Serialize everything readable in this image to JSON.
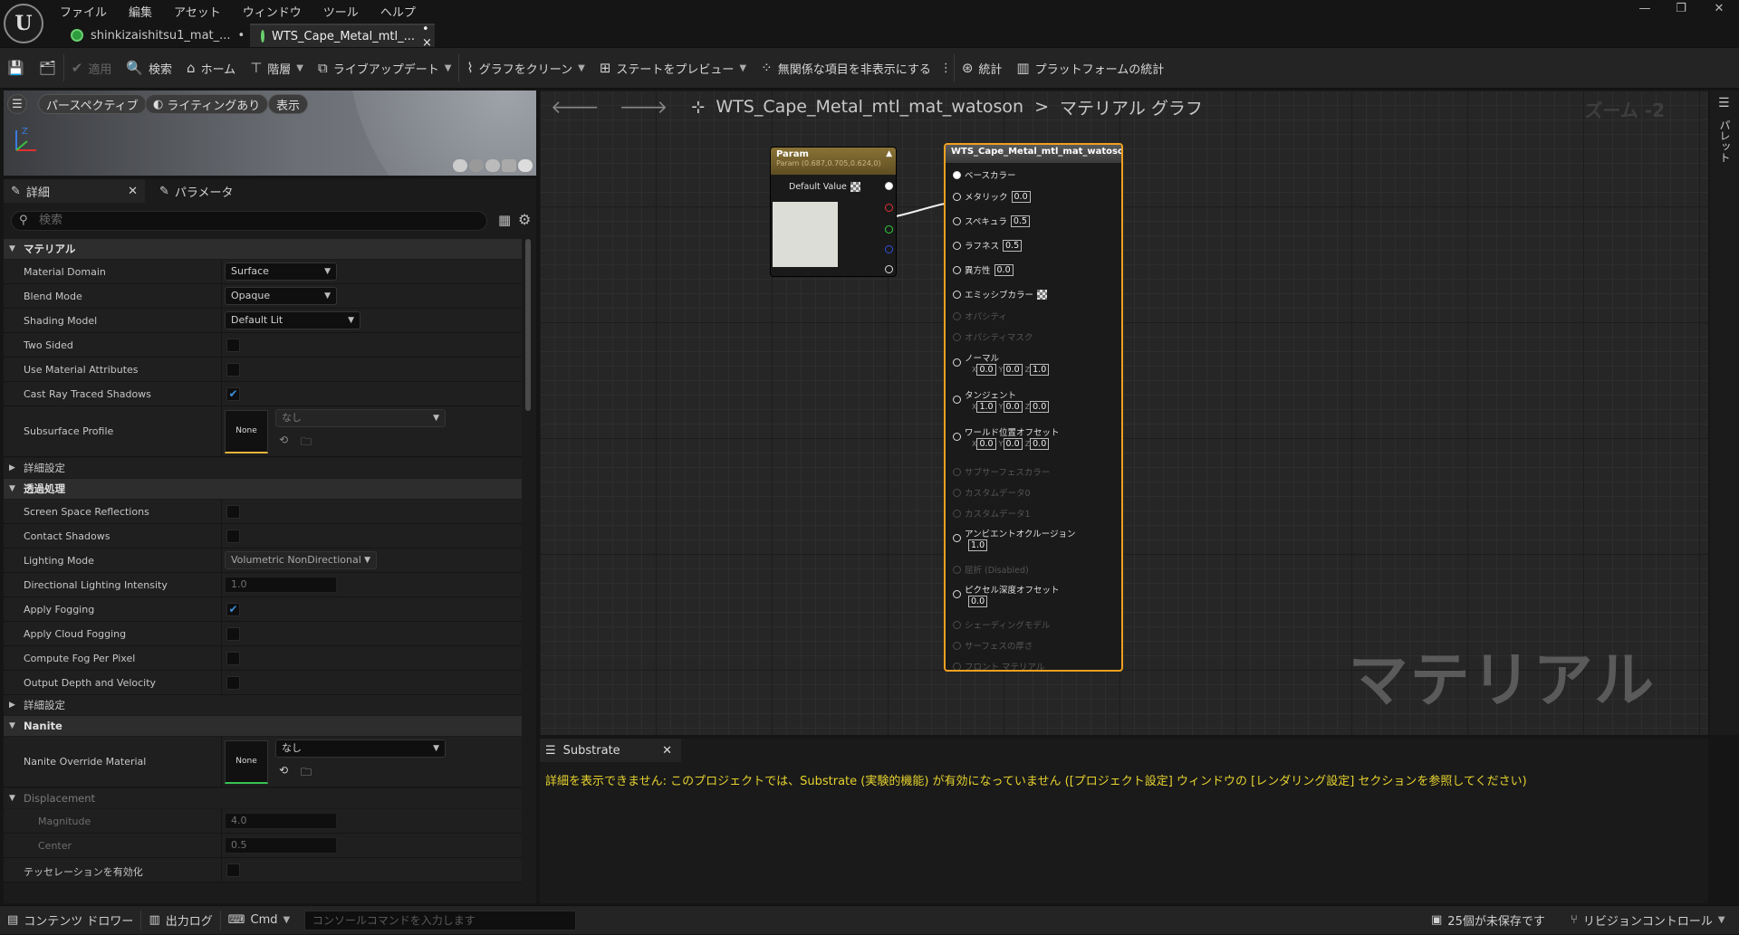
{
  "menu": [
    "ファイル",
    "編集",
    "アセット",
    "ウィンドウ",
    "ツール",
    "ヘルプ"
  ],
  "tabs": [
    {
      "label": "shinkizaishitsu1_mat_...",
      "marker": "•"
    },
    {
      "label": "WTS_Cape_Metal_mtl_...",
      "marker": "• ×"
    }
  ],
  "toolbar": {
    "apply": "適用",
    "search": "検索",
    "home": "ホーム",
    "hierarchy": "階層",
    "live_update": "ライブアップデート",
    "clean_graph": "グラフをクリーン",
    "preview_state": "ステートをプレビュー",
    "hide_unrelated": "無関係な項目を非表示にする",
    "stats": "統計",
    "platform_stats": "プラットフォームの統計"
  },
  "viewport": {
    "perspective": "パースペクティブ",
    "lighting": "ライティングあり",
    "show": "表示"
  },
  "panel": {
    "details_tab": "詳細",
    "params_tab": "パラメータ",
    "search_placeholder": "検索"
  },
  "sections": {
    "material": "マテリアル",
    "advanced1": "詳細設定",
    "translucency": "透過処理",
    "advanced2": "詳細設定",
    "nanite": "Nanite",
    "displacement": "Displacement"
  },
  "props": {
    "material_domain": {
      "label": "Material Domain",
      "value": "Surface"
    },
    "blend_mode": {
      "label": "Blend Mode",
      "value": "Opaque"
    },
    "shading_model": {
      "label": "Shading Model",
      "value": "Default Lit"
    },
    "two_sided": {
      "label": "Two Sided",
      "checked": false
    },
    "use_mat_attr": {
      "label": "Use Material Attributes",
      "checked": false
    },
    "cast_rt": {
      "label": "Cast Ray Traced Shadows",
      "checked": true
    },
    "subsurface": {
      "label": "Subsurface Profile",
      "thumb": "None",
      "value": "なし"
    },
    "ssr": {
      "label": "Screen Space Reflections",
      "checked": false
    },
    "contact": {
      "label": "Contact Shadows",
      "checked": false
    },
    "lighting_mode": {
      "label": "Lighting Mode",
      "value": "Volumetric NonDirectional"
    },
    "dir_light": {
      "label": "Directional Lighting Intensity",
      "value": "1.0"
    },
    "apply_fog": {
      "label": "Apply Fogging",
      "checked": true
    },
    "cloud_fog": {
      "label": "Apply Cloud Fogging",
      "checked": false
    },
    "fog_pixel": {
      "label": "Compute Fog Per Pixel",
      "checked": false
    },
    "depth_vel": {
      "label": "Output Depth and Velocity",
      "checked": false
    },
    "nanite_override": {
      "label": "Nanite Override Material",
      "thumb": "None",
      "value": "なし"
    },
    "magnitude": {
      "label": "Magnitude",
      "value": "4.0"
    },
    "center": {
      "label": "Center",
      "value": "0.5"
    },
    "tessellation": {
      "label": "テッセレーションを有効化",
      "checked": false
    }
  },
  "graph": {
    "breadcrumb_asset": "WTS_Cape_Metal_mtl_mat_watoson",
    "breadcrumb_sep": ">",
    "breadcrumb_graph": "マテリアル グラフ",
    "zoom": "ズーム -2",
    "watermark": "マテリアル",
    "palette": "パレット",
    "param_node": {
      "title": "Param",
      "subtitle": "Param (0.687,0.705,0.624,0)",
      "default_value": "Default Value",
      "swatch_color": "#dcddd6"
    },
    "result_node": {
      "title": "WTS_Cape_Metal_mtl_mat_watoson",
      "base_color": "ベースカラー",
      "metallic": {
        "label": "メタリック",
        "value": "0.0"
      },
      "specular": {
        "label": "スペキュラ",
        "value": "0.5"
      },
      "roughness": {
        "label": "ラフネス",
        "value": "0.5"
      },
      "anisotropy": {
        "label": "異方性",
        "value": "0.0"
      },
      "emissive": "エミッシブカラー",
      "opacity": "オパシティ",
      "opacity_mask": "オパシティマスク",
      "normal": {
        "label": "ノーマル",
        "x": "0.0",
        "y": "0.0",
        "z": "1.0"
      },
      "tangent": {
        "label": "タンジェント",
        "x": "1.0",
        "y": "0.0",
        "z": "0.0"
      },
      "wpo": {
        "label": "ワールド位置オフセット",
        "x": "0.0",
        "y": "0.0",
        "z": "0.0"
      },
      "subsurface_color": "サブサーフェスカラー",
      "custom0": "カスタムデータ0",
      "custom1": "カスタムデータ1",
      "ao": {
        "label": "アンビエントオクルージョン",
        "value": "1.0"
      },
      "refraction": "屈折 (Disabled)",
      "pdo": {
        "label": "ピクセル深度オフセット",
        "value": "0.0"
      },
      "shading_model": "シェーディングモデル",
      "surface_thickness": "サーフェスの厚さ",
      "front_material": "フロント マテリアル",
      "axis_x": "X",
      "axis_y": "Y",
      "axis_z": "Z"
    }
  },
  "substrate": {
    "tab": "Substrate",
    "message": "詳細を表示できません: このプロジェクトでは、Substrate (実験的機能) が有効になっていません ([プロジェクト設定] ウィンドウの [レンダリング設定] セクションを参照してください)"
  },
  "status": {
    "content_drawer": "コンテンツ ドロワー",
    "output_log": "出力ログ",
    "cmd": "Cmd",
    "console_placeholder": "コンソールコマンドを入力します",
    "unsaved": "25個が未保存です",
    "revision": "リビジョンコントロール"
  }
}
